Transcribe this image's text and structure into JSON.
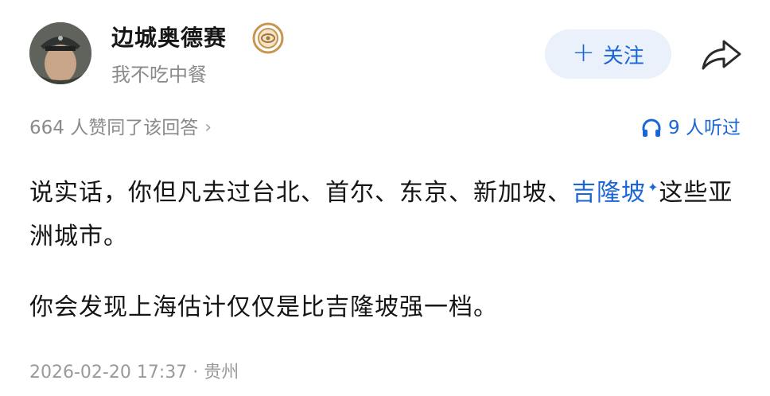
{
  "author": {
    "name": "边城奥德赛",
    "bio": "我不吃中餐"
  },
  "follow_button": {
    "plus": "+",
    "label": "关注"
  },
  "stats": {
    "likes": "664 人赞同了该回答",
    "chevron": "›",
    "listeners": "9 人听过"
  },
  "answer": {
    "p1_text": "说实话，你但凡去过台北、首尔、东京、新加坡、",
    "p1_keyword": "吉隆坡",
    "p1_keyword_mark": "✦",
    "p1_tail": "这些亚洲城市。",
    "p2_text": "你会发现上海估计仅仅是比吉隆坡强一档。"
  },
  "meta": {
    "timestamp": "2026-02-20 17:37 · 贵州"
  },
  "colors": {
    "accent": "#1a66d6",
    "follow_bg": "#eaf1fb",
    "muted_text": "#8a8a8a",
    "badge": "#c9954f"
  },
  "icons": [
    "avatar",
    "verified-badge-icon",
    "share-icon",
    "headphone-icon",
    "chevron-right-icon",
    "sparkle-icon"
  ]
}
